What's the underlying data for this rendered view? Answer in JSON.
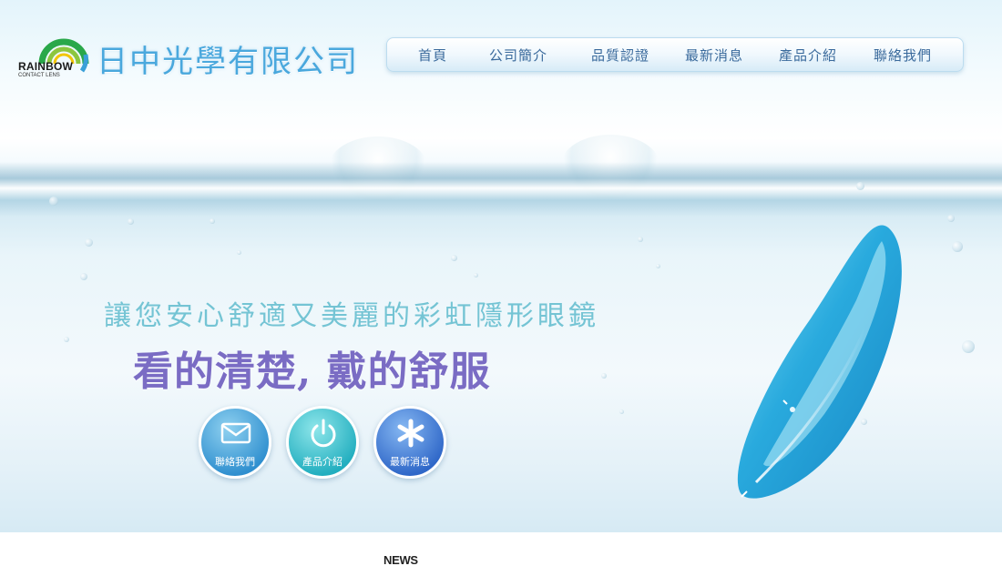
{
  "logo": {
    "brand": "RAINBOW",
    "subtitle": "CONTACT LENS",
    "company_name": "日中光學有限公司",
    "ring_colors": [
      "#2aa84a",
      "#8cc63f",
      "#f2c500",
      "#3aa0d8"
    ]
  },
  "nav": {
    "items": [
      {
        "label": "首頁"
      },
      {
        "label": "公司簡介"
      },
      {
        "label": "品質認證"
      },
      {
        "label": "最新消息"
      },
      {
        "label": "產品介紹"
      },
      {
        "label": "聯絡我們"
      }
    ]
  },
  "hero": {
    "tagline": "讓您安心舒適又美麗的彩虹隱形眼鏡",
    "slogan": "看的清楚, 戴的舒服",
    "buttons": [
      {
        "label": "聯絡我們",
        "icon": "envelope-icon"
      },
      {
        "label": "產品介紹",
        "icon": "power-icon"
      },
      {
        "label": "最新消息",
        "icon": "asterisk-icon"
      }
    ]
  },
  "news": {
    "heading": "NEWS"
  },
  "colors": {
    "nav_text": "#3a6a9c",
    "company_name": "#4aa8dd",
    "tagline": "#74c4d4",
    "slogan": "#7a6cc4",
    "lens": "#1fa6dc"
  }
}
